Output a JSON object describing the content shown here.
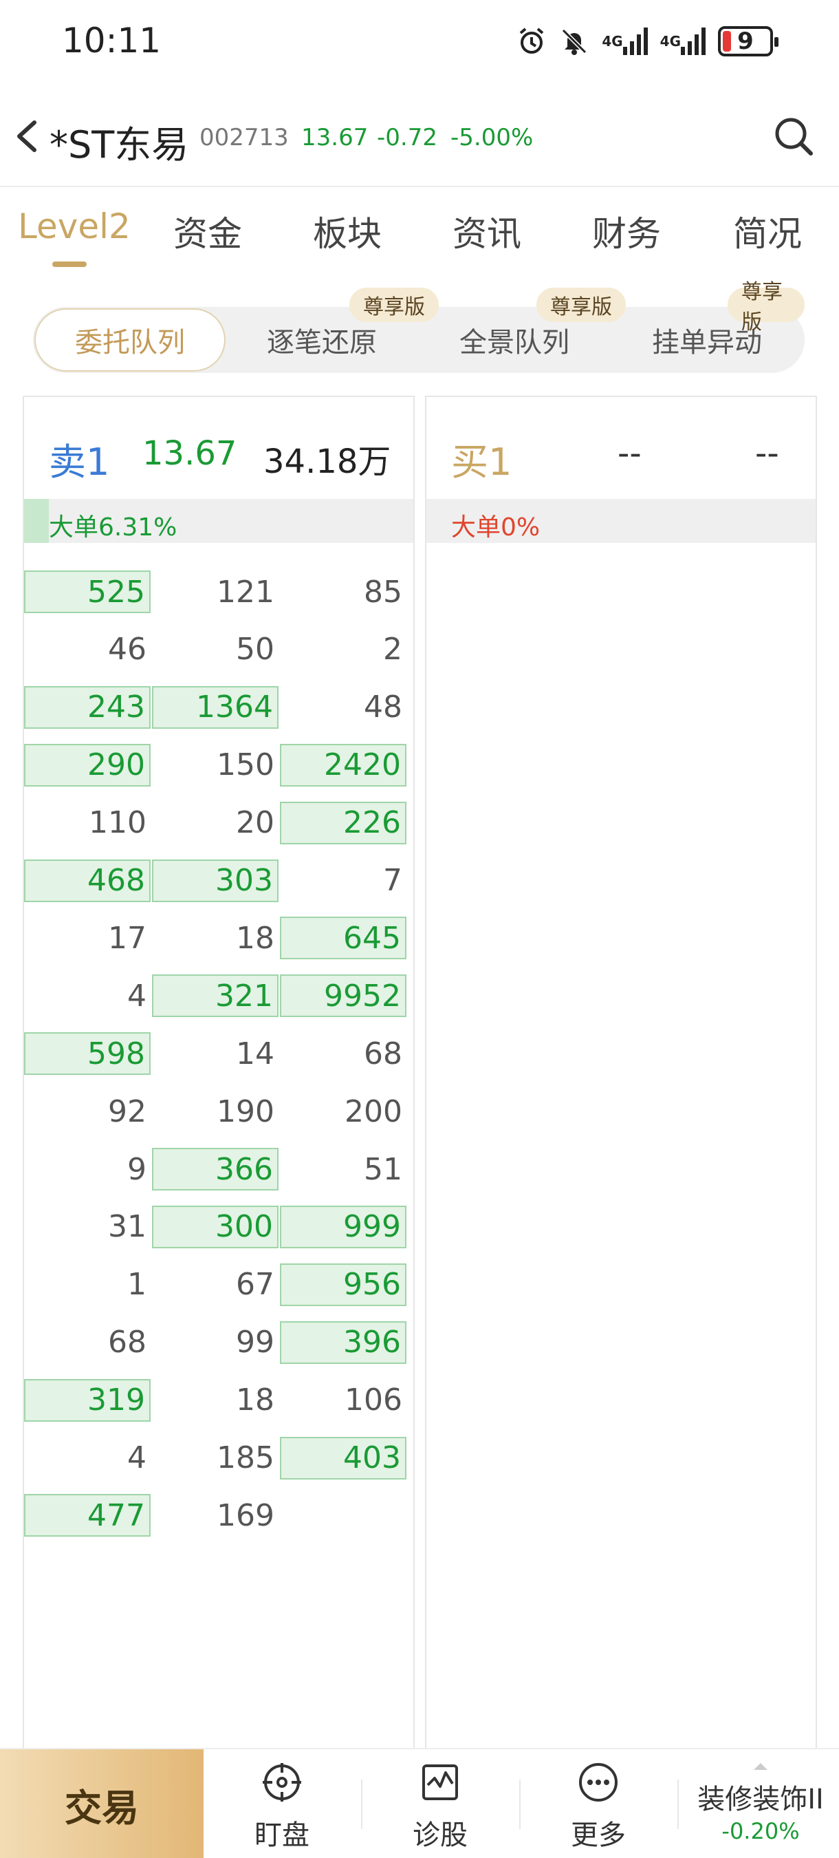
{
  "status_bar": {
    "time": "10:11",
    "signal1": "4G",
    "signal2": "4G",
    "battery": "9"
  },
  "header": {
    "stock_name": "*ST东易",
    "stock_code": "002713",
    "price": "13.67",
    "change": "-0.72",
    "change_pct": "-5.00%"
  },
  "tabs": [
    "Level2",
    "资金",
    "板块",
    "资讯",
    "财务",
    "简况"
  ],
  "segments": {
    "items": [
      "委托队列",
      "逐笔还原",
      "全景队列",
      "挂单异动"
    ],
    "badge": "尊享版"
  },
  "sell": {
    "label": "卖1",
    "price": "13.67",
    "volume": "34.18万",
    "big_order": "大单6.31%",
    "big_order_fraction": 0.0631
  },
  "buy": {
    "label": "买1",
    "price": "--",
    "volume": "--",
    "big_order": "大单0%"
  },
  "queue": [
    [
      {
        "v": "525",
        "h": true
      },
      {
        "v": "121",
        "h": false
      },
      {
        "v": "85",
        "h": false
      }
    ],
    [
      {
        "v": "46",
        "h": false
      },
      {
        "v": "50",
        "h": false
      },
      {
        "v": "2",
        "h": false
      }
    ],
    [
      {
        "v": "243",
        "h": true
      },
      {
        "v": "1364",
        "h": true
      },
      {
        "v": "48",
        "h": false
      }
    ],
    [
      {
        "v": "290",
        "h": true
      },
      {
        "v": "150",
        "h": false
      },
      {
        "v": "2420",
        "h": true
      }
    ],
    [
      {
        "v": "110",
        "h": false
      },
      {
        "v": "20",
        "h": false
      },
      {
        "v": "226",
        "h": true
      }
    ],
    [
      {
        "v": "468",
        "h": true
      },
      {
        "v": "303",
        "h": true
      },
      {
        "v": "7",
        "h": false
      }
    ],
    [
      {
        "v": "17",
        "h": false
      },
      {
        "v": "18",
        "h": false
      },
      {
        "v": "645",
        "h": true
      }
    ],
    [
      {
        "v": "4",
        "h": false
      },
      {
        "v": "321",
        "h": true
      },
      {
        "v": "9952",
        "h": true
      }
    ],
    [
      {
        "v": "598",
        "h": true
      },
      {
        "v": "14",
        "h": false
      },
      {
        "v": "68",
        "h": false
      }
    ],
    [
      {
        "v": "92",
        "h": false
      },
      {
        "v": "190",
        "h": false
      },
      {
        "v": "200",
        "h": false
      }
    ],
    [
      {
        "v": "9",
        "h": false
      },
      {
        "v": "366",
        "h": true
      },
      {
        "v": "51",
        "h": false
      }
    ],
    [
      {
        "v": "31",
        "h": false
      },
      {
        "v": "300",
        "h": true
      },
      {
        "v": "999",
        "h": true
      }
    ],
    [
      {
        "v": "1",
        "h": false
      },
      {
        "v": "67",
        "h": false
      },
      {
        "v": "956",
        "h": true
      }
    ],
    [
      {
        "v": "68",
        "h": false
      },
      {
        "v": "99",
        "h": false
      },
      {
        "v": "396",
        "h": true
      }
    ],
    [
      {
        "v": "319",
        "h": true
      },
      {
        "v": "18",
        "h": false
      },
      {
        "v": "106",
        "h": false
      }
    ],
    [
      {
        "v": "4",
        "h": false
      },
      {
        "v": "185",
        "h": false
      },
      {
        "v": "403",
        "h": true
      }
    ],
    [
      {
        "v": "477",
        "h": true
      },
      {
        "v": "169",
        "h": false
      }
    ]
  ],
  "bottom_nav": {
    "trade": "交易",
    "items": [
      {
        "label": "盯盘",
        "icon": "target-icon"
      },
      {
        "label": "诊股",
        "icon": "pulse-chart-icon"
      },
      {
        "label": "更多",
        "icon": "more-dots-icon"
      }
    ],
    "sector_name": "装修装饰II",
    "sector_pct": "-0.20%"
  },
  "colors": {
    "accent_gold": "#c9a663",
    "down_green": "#1a9a35",
    "sell_blue": "#3a7bd5",
    "buy_gold": "#c9a663",
    "big_order_red": "#e0452e"
  }
}
